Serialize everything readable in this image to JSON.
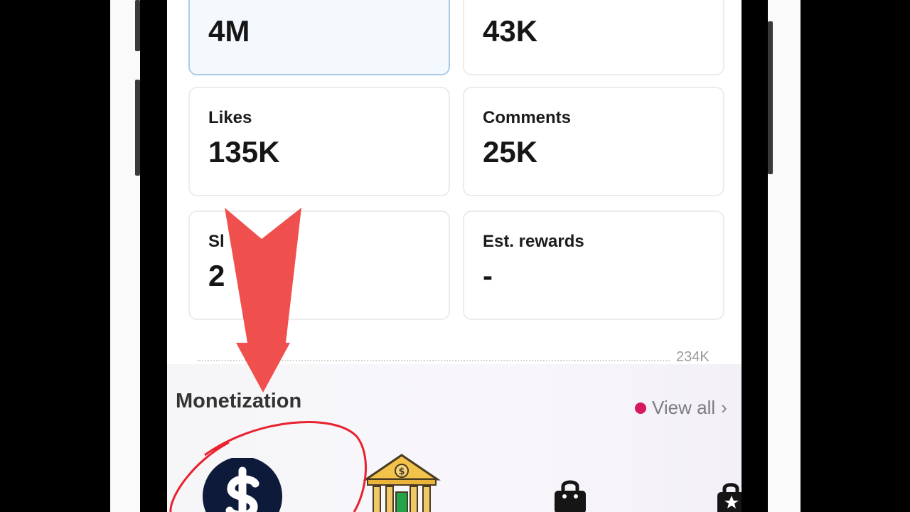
{
  "stats": {
    "cards": [
      {
        "label": "",
        "value": "4M"
      },
      {
        "label": "",
        "value": "43K"
      },
      {
        "label": "Likes",
        "value": "135K"
      },
      {
        "label": "Comments",
        "value": "25K"
      },
      {
        "label": "Sl",
        "value": "2"
      },
      {
        "label": "Est. rewards",
        "value": "-"
      }
    ]
  },
  "chart": {
    "axis_label": "234K"
  },
  "monetization": {
    "title": "Monetization",
    "view_all": "View all",
    "view_all_chevron": "›",
    "notification_color": "#d6195d",
    "icons": [
      "dollar-coin-icon",
      "bank-icon",
      "shopping-bag-icon",
      "shopping-bag-star-icon"
    ]
  },
  "overlay": {
    "arrow_color": "#f0504d",
    "circle_color": "#e8222f"
  }
}
